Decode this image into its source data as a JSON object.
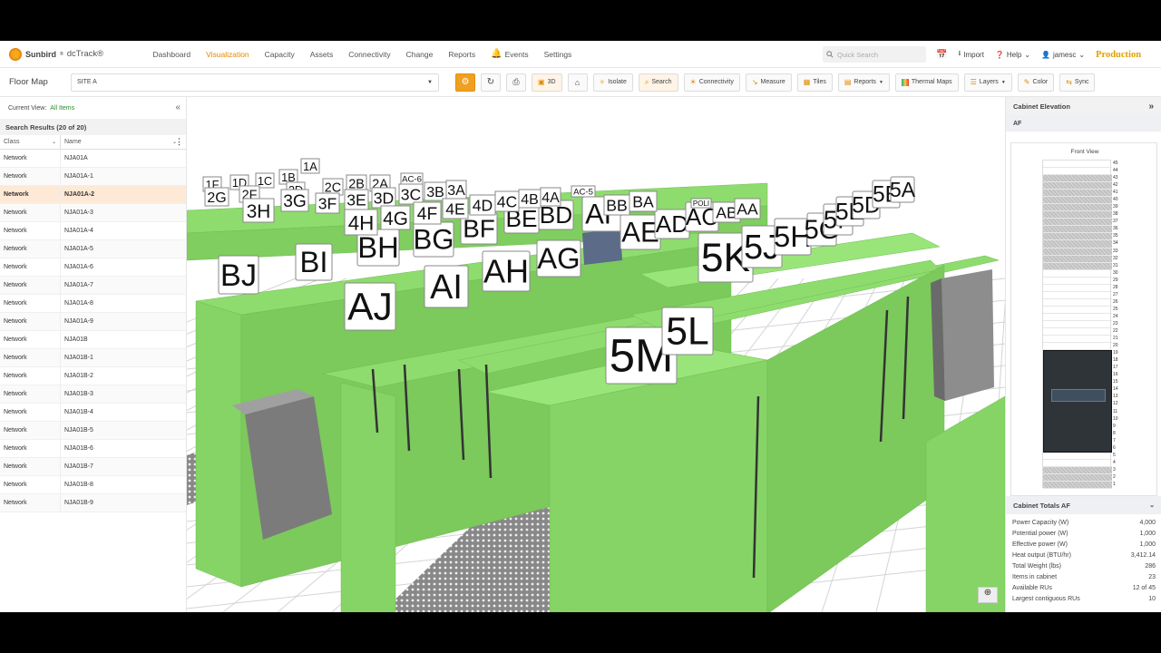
{
  "app": {
    "brand": "Sunbird",
    "product": "dcTrack®",
    "brand_mark": "®"
  },
  "nav": {
    "items": [
      "Dashboard",
      "Visualization",
      "Capacity",
      "Assets",
      "Connectivity",
      "Change",
      "Reports",
      "Events",
      "Settings"
    ],
    "active": "Visualization"
  },
  "search": {
    "placeholder": "Quick Search"
  },
  "topright": {
    "import": "Import",
    "help": "Help",
    "user": "jamesc",
    "env": "Production"
  },
  "toolbar": {
    "page_title": "Floor Map",
    "site": "SITE A",
    "buttons": {
      "view3d": "3D",
      "isolate": "Isolate",
      "search": "Search",
      "connectivity": "Connectivity",
      "measure": "Measure",
      "tiles": "Tiles",
      "reports": "Reports",
      "thermal": "Thermal Maps",
      "layers": "Layers",
      "color": "Color",
      "sync": "Sync"
    }
  },
  "left": {
    "current_view_label": "Current View:",
    "current_view_value": "All Items",
    "results_title": "Search Results (20 of 20)",
    "col_class": "Class",
    "col_name": "Name",
    "rows": [
      {
        "cls": "Network",
        "name": "NJA01A"
      },
      {
        "cls": "Network",
        "name": "NJA01A-1"
      },
      {
        "cls": "Network",
        "name": "NJA01A-2"
      },
      {
        "cls": "Network",
        "name": "NJA01A-3"
      },
      {
        "cls": "Network",
        "name": "NJA01A-4"
      },
      {
        "cls": "Network",
        "name": "NJA01A-5"
      },
      {
        "cls": "Network",
        "name": "NJA01A-6"
      },
      {
        "cls": "Network",
        "name": "NJA01A-7"
      },
      {
        "cls": "Network",
        "name": "NJA01A-8"
      },
      {
        "cls": "Network",
        "name": "NJA01A-9"
      },
      {
        "cls": "Network",
        "name": "NJA01B"
      },
      {
        "cls": "Network",
        "name": "NJA01B-1"
      },
      {
        "cls": "Network",
        "name": "NJA01B-2"
      },
      {
        "cls": "Network",
        "name": "NJA01B-3"
      },
      {
        "cls": "Network",
        "name": "NJA01B-4"
      },
      {
        "cls": "Network",
        "name": "NJA01B-5"
      },
      {
        "cls": "Network",
        "name": "NJA01B-6"
      },
      {
        "cls": "Network",
        "name": "NJA01B-7"
      },
      {
        "cls": "Network",
        "name": "NJA01B-8"
      },
      {
        "cls": "Network",
        "name": "NJA01B-9"
      }
    ],
    "selected_row": "NJA01A-2"
  },
  "scene": {
    "rack_color": "#8fdc6e",
    "labels_big": [
      "BJ",
      "BI",
      "AJ",
      "BH",
      "AI",
      "BG",
      "AH",
      "AG",
      "BF",
      "BE",
      "BD",
      "AF",
      "AE",
      "AD",
      "AC",
      "5K",
      "5J",
      "5H",
      "5M",
      "5L",
      "5G",
      "5F",
      "5E",
      "5D",
      "5B",
      "5A"
    ],
    "labels_small": [
      "1A",
      "1B",
      "1C",
      "1D",
      "1F",
      "2F",
      "2G",
      "2D",
      "2C",
      "2B",
      "2A",
      "3H",
      "3G",
      "3F",
      "3E",
      "3D",
      "3C",
      "3B",
      "3A",
      "4H",
      "4G",
      "4F",
      "4E",
      "4D",
      "4C",
      "4B",
      "4A",
      "AC-6",
      "AC-5",
      "BB",
      "BA",
      "AB",
      "AA",
      "POLI"
    ]
  },
  "right": {
    "title": "Cabinet Elevation",
    "cabinet": "AF",
    "front_view": "Front View",
    "ru_count": 45,
    "occupied_ru": [
      1,
      2,
      3,
      31,
      32,
      33,
      34,
      35,
      36,
      37,
      38,
      39,
      40,
      41,
      42,
      43
    ],
    "device_ru": [
      6,
      19
    ],
    "totals_title": "Cabinet Totals AF",
    "totals": [
      {
        "k": "Power Capacity (W)",
        "v": "4,000"
      },
      {
        "k": "Potential power (W)",
        "v": "1,000"
      },
      {
        "k": "Effective power (W)",
        "v": "1,000"
      },
      {
        "k": "Heat output (BTU/hr)",
        "v": "3,412.14"
      },
      {
        "k": "Total Weight (lbs)",
        "v": "286"
      },
      {
        "k": "Items in cabinet",
        "v": "23"
      },
      {
        "k": "Available RUs",
        "v": "12 of 45"
      },
      {
        "k": "Largest contiguous RUs",
        "v": "10"
      }
    ]
  }
}
